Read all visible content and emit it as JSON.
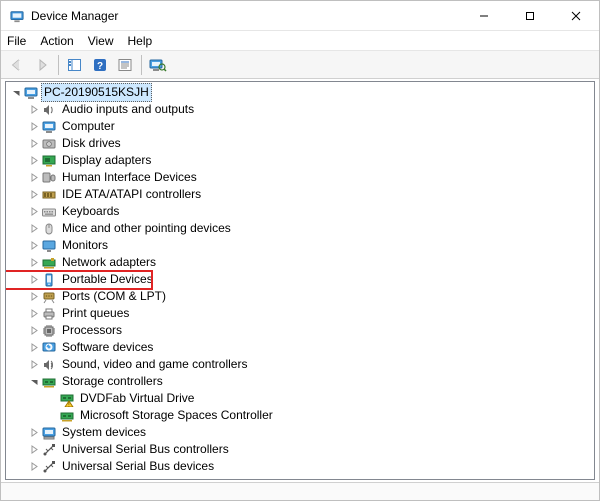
{
  "window": {
    "title": "Device Manager"
  },
  "menubar": {
    "items": [
      "File",
      "Action",
      "View",
      "Help"
    ]
  },
  "toolbar": {
    "icons": [
      "back-arrow-icon",
      "forward-arrow-icon",
      "sep",
      "show-hide-tree-icon",
      "help-icon",
      "properties-icon",
      "sep",
      "scan-hardware-icon"
    ]
  },
  "tree": {
    "root": {
      "label": "PC-20190515KSJH",
      "expanded": true,
      "icon": "computer-icon",
      "selected": true
    },
    "nodes": [
      {
        "label": "Audio inputs and outputs",
        "icon": "audio-icon",
        "expanded": false
      },
      {
        "label": "Computer",
        "icon": "computer-icon",
        "expanded": false
      },
      {
        "label": "Disk drives",
        "icon": "disk-icon",
        "expanded": false
      },
      {
        "label": "Display adapters",
        "icon": "display-adapter-icon",
        "expanded": false
      },
      {
        "label": "Human Interface Devices",
        "icon": "hid-icon",
        "expanded": false
      },
      {
        "label": "IDE ATA/ATAPI controllers",
        "icon": "ide-icon",
        "expanded": false
      },
      {
        "label": "Keyboards",
        "icon": "keyboard-icon",
        "expanded": false
      },
      {
        "label": "Mice and other pointing devices",
        "icon": "mouse-icon",
        "expanded": false
      },
      {
        "label": "Monitors",
        "icon": "monitor-icon",
        "expanded": false
      },
      {
        "label": "Network adapters",
        "icon": "network-adapter-icon",
        "expanded": false
      },
      {
        "label": "Portable Devices",
        "icon": "portable-device-icon",
        "expanded": false,
        "highlight": true
      },
      {
        "label": "Ports (COM & LPT)",
        "icon": "port-icon",
        "expanded": false
      },
      {
        "label": "Print queues",
        "icon": "printer-icon",
        "expanded": false
      },
      {
        "label": "Processors",
        "icon": "processor-icon",
        "expanded": false
      },
      {
        "label": "Software devices",
        "icon": "software-device-icon",
        "expanded": false
      },
      {
        "label": "Sound, video and game controllers",
        "icon": "sound-video-icon",
        "expanded": false
      },
      {
        "label": "Storage controllers",
        "icon": "storage-controller-icon",
        "expanded": true,
        "children": [
          {
            "label": "DVDFab Virtual Drive",
            "icon": "storage-controller-warning-icon"
          },
          {
            "label": "Microsoft Storage Spaces Controller",
            "icon": "storage-controller-icon"
          }
        ]
      },
      {
        "label": "System devices",
        "icon": "system-device-icon",
        "expanded": false
      },
      {
        "label": "Universal Serial Bus controllers",
        "icon": "usb-icon",
        "expanded": false
      },
      {
        "label": "Universal Serial Bus devices",
        "icon": "usb-icon",
        "expanded": false
      }
    ]
  }
}
